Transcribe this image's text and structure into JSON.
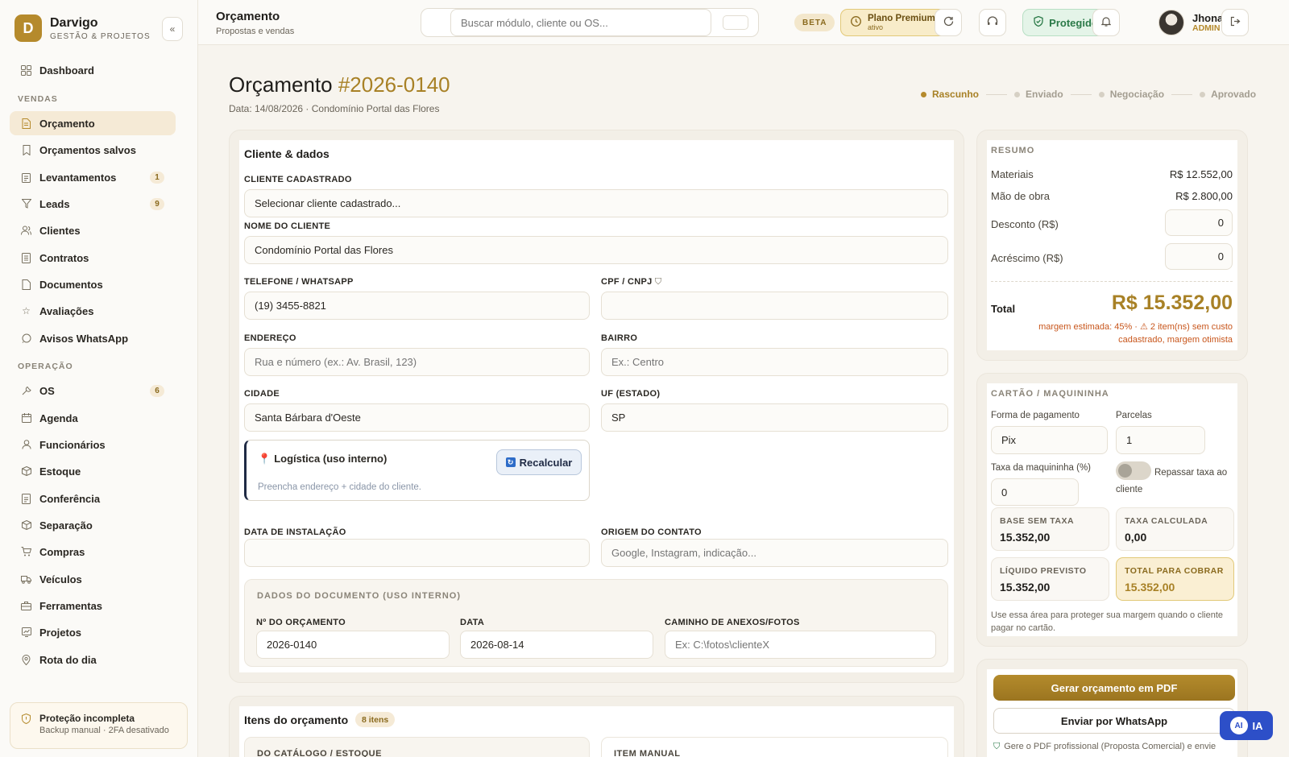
{
  "brand": {
    "initial": "D",
    "name": "Darvigo",
    "subtitle": "GESTÃO & PROJETOS"
  },
  "sidebar": {
    "collapse_icon": "«",
    "dashboard": "Dashboard",
    "section_sales": "VENDAS",
    "sales_items": [
      {
        "label": "Orçamento",
        "icon": "document-icon",
        "active": true,
        "badge": ""
      },
      {
        "label": "Orçamentos salvos",
        "icon": "bookmark-icon",
        "badge": ""
      },
      {
        "label": "Levantamentos",
        "icon": "clipboard-icon",
        "badge": "1"
      },
      {
        "label": "Leads",
        "icon": "filter-icon",
        "badge": "9"
      },
      {
        "label": "Clientes",
        "icon": "users-icon",
        "badge": ""
      },
      {
        "label": "Contratos",
        "icon": "contract-icon",
        "badge": ""
      },
      {
        "label": "Documentos",
        "icon": "file-icon",
        "badge": ""
      },
      {
        "label": "Avaliações",
        "icon": "star-icon",
        "badge": ""
      },
      {
        "label": "Avisos WhatsApp",
        "icon": "chat-icon",
        "badge": ""
      }
    ],
    "section_ops": "OPERAÇÃO",
    "ops_items": [
      {
        "label": "OS",
        "icon": "wrench-icon",
        "badge": "6"
      },
      {
        "label": "Agenda",
        "icon": "calendar-icon",
        "badge": ""
      },
      {
        "label": "Funcionários",
        "icon": "user-icon",
        "badge": ""
      },
      {
        "label": "Estoque",
        "icon": "box-icon",
        "badge": ""
      },
      {
        "label": "Conferência",
        "icon": "checklist-icon",
        "badge": ""
      },
      {
        "label": "Separação",
        "icon": "package-icon",
        "badge": ""
      },
      {
        "label": "Compras",
        "icon": "cart-icon",
        "badge": ""
      },
      {
        "label": "Veículos",
        "icon": "truck-icon",
        "badge": ""
      },
      {
        "label": "Ferramentas",
        "icon": "toolbox-icon",
        "badge": ""
      },
      {
        "label": "Projetos",
        "icon": "chart-icon",
        "badge": ""
      },
      {
        "label": "Rota do dia",
        "icon": "pin-icon",
        "badge": ""
      }
    ],
    "protection": {
      "title": "Proteção incompleta",
      "subtitle": "Backup manual · 2FA desativado"
    }
  },
  "header": {
    "title": "Orçamento",
    "subtitle": "Propostas e vendas",
    "search_placeholder": "Buscar módulo, cliente ou OS...",
    "beta": "BETA",
    "premium_title": "Plano Premium",
    "premium_sub": "ativo",
    "protected": "Protegido",
    "user_name": "Jhonatan",
    "user_role": "ADMIN"
  },
  "page": {
    "title_prefix": "Orçamento ",
    "title_number": "#2026-0140",
    "subtitle": "Data: 14/08/2026 · Condomínio Portal das Flores",
    "steps": [
      "Rascunho",
      "Enviado",
      "Negociação",
      "Aprovado"
    ]
  },
  "client": {
    "title": "Cliente & dados",
    "registered_label": "CLIENTE CADASTRADO",
    "registered_value": "Selecionar cliente cadastrado...",
    "name_label": "NOME DO CLIENTE",
    "name_value": "Condomínio Portal das Flores",
    "phone_label": "TELEFONE / WHATSAPP",
    "phone_value": "(19) 3455-8821",
    "cpf_label": "CPF / CNPJ",
    "cpf_value": "",
    "address_label": "ENDEREÇO",
    "address_placeholder": "Rua e número (ex.: Av. Brasil, 123)",
    "district_label": "BAIRRO",
    "district_placeholder": "Ex.: Centro",
    "city_label": "CIDADE",
    "city_value": "Santa Bárbara d'Oeste",
    "state_label": "UF (ESTADO)",
    "state_value": "SP",
    "logistics_title": "Logística (uso interno)",
    "logistics_sub": "Preencha endereço + cidade do cliente.",
    "recalc": "Recalcular",
    "install_label": "DATA DE INSTALAÇÃO",
    "install_value": "",
    "origin_label": "ORIGEM DO CONTATO",
    "origin_placeholder": "Google, Instagram, indicação...",
    "doc_title": "DADOS DO DOCUMENTO (USO INTERNO)",
    "doc_number_label": "Nº DO ORÇAMENTO",
    "doc_number_value": "2026-0140",
    "doc_date_label": "DATA",
    "doc_date_value": "2026-08-14",
    "doc_path_label": "CAMINHO DE ANEXOS/FOTOS",
    "doc_path_placeholder": "Ex: C:\\fotos\\clienteX"
  },
  "items": {
    "title": "Itens do orçamento",
    "count": "8 itens",
    "catalog_label": "DO CATÁLOGO / ESTOQUE",
    "manual_label": "ITEM MANUAL"
  },
  "summary": {
    "title": "RESUMO",
    "materials_label": "Materiais",
    "materials_value": "R$ 12.552,00",
    "labor_label": "Mão de obra",
    "labor_value": "R$ 2.800,00",
    "discount_label": "Desconto (R$)",
    "discount_value": "0",
    "surcharge_label": "Acréscimo (R$)",
    "surcharge_value": "0",
    "total_label": "Total",
    "total_value": "R$ 15.352,00",
    "margin_note": "margem estimada: 45% · ⚠ 2 item(ns) sem custo cadastrado, margem otimista"
  },
  "card": {
    "title": "CARTÃO / MAQUININHA",
    "payment_label": "Forma de pagamento",
    "payment_value": "Pix",
    "installments_label": "Parcelas",
    "installments_value": "1",
    "fee_label": "Taxa da maquininha (%)",
    "fee_value": "0",
    "pass_fee_label": "Repassar taxa ao cliente",
    "pass_fee_on": false,
    "base_label": "BASE SEM TAXA",
    "base_value": "15.352,00",
    "calc_label": "TAXA CALCULADA",
    "calc_value": "0,00",
    "net_label": "LÍQUIDO PREVISTO",
    "net_value": "15.352,00",
    "charge_label": "TOTAL PARA COBRAR",
    "charge_value": "15.352,00",
    "note": "Use essa área para proteger sua margem quando o cliente pagar no cartão."
  },
  "actions": {
    "pdf": "Gerar orçamento em PDF",
    "whatsapp": "Enviar por WhatsApp",
    "note": "Gere o PDF profissional (Proposta Comercial) e envie",
    "ai": "IA",
    "ai_badge": "AI"
  },
  "colors": {
    "accent": "#b58a2c",
    "success": "#2b7a48",
    "warning": "#c8561c"
  }
}
